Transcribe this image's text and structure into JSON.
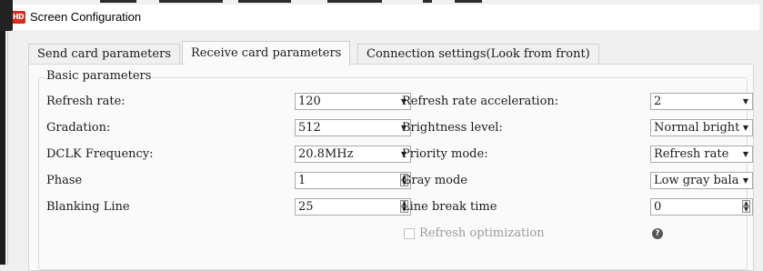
{
  "window": {
    "title": "Screen Configuration",
    "app_icon_text": "HD"
  },
  "tabs": [
    {
      "label": "Send card parameters",
      "active": false
    },
    {
      "label": "Receive card parameters",
      "active": true
    },
    {
      "label": "Connection settings(Look from front)",
      "active": false
    }
  ],
  "group": {
    "title": "Basic parameters"
  },
  "left": {
    "refresh_rate": {
      "label": "Refresh rate:",
      "value": "120",
      "type": "select"
    },
    "gradation": {
      "label": "Gradation:",
      "value": "512",
      "type": "select"
    },
    "dclk": {
      "label": "DCLK Frequency:",
      "value": "20.8MHz",
      "type": "select"
    },
    "phase": {
      "label": "Phase",
      "value": "1",
      "type": "spin"
    },
    "blanking": {
      "label": "Blanking Line",
      "value": "25",
      "type": "spin"
    }
  },
  "right": {
    "refresh_accel": {
      "label": "Refresh rate acceleration:",
      "value": "2",
      "type": "select"
    },
    "brightness": {
      "label": "Brightness level:",
      "value": "Normal bright",
      "type": "select"
    },
    "priority": {
      "label": "Priority mode:",
      "value": "Refresh rate",
      "type": "select"
    },
    "gray_mode": {
      "label": "Gray mode",
      "value": "Low gray bala",
      "type": "select"
    },
    "line_break": {
      "label": "Line break time",
      "value": "0",
      "type": "spin"
    }
  },
  "refresh_optimization": {
    "label": "Refresh optimization",
    "checked": false,
    "enabled": false
  },
  "icons": {
    "help": "question-circle-icon"
  }
}
